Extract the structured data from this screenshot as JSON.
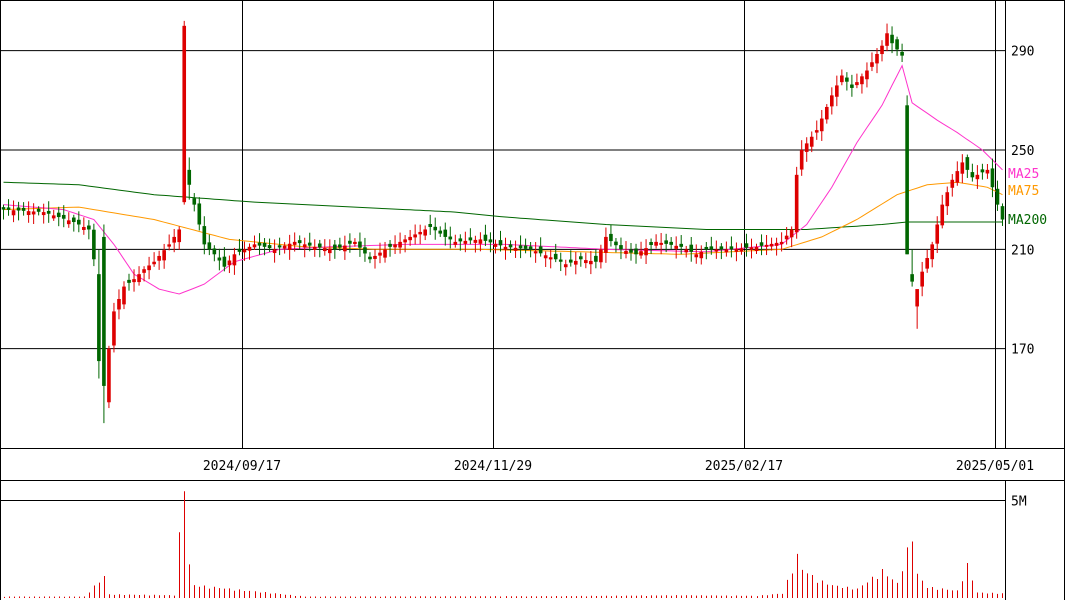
{
  "chart_data": {
    "type": "candlestick",
    "price_axis": {
      "ylim": [
        130,
        310
      ],
      "ticks": [
        290,
        250,
        210,
        170
      ],
      "tick_labels": [
        "290",
        "250",
        "210",
        "170"
      ]
    },
    "volume_axis": {
      "ylim": [
        0,
        6
      ],
      "unit": "M",
      "ticks": [
        5
      ],
      "tick_labels": [
        "5M"
      ]
    },
    "x_axis": {
      "dates": [
        "2024/09/17",
        "2024/11/29",
        "2025/02/17",
        "2025/05/01"
      ],
      "date_index": [
        48,
        98,
        148,
        198
      ],
      "n_sessions": 200
    },
    "colors": {
      "up": "#dd0000",
      "down": "#006600",
      "ma25": "#ff33cc",
      "ma75": "#ff9900",
      "ma200": "#006600",
      "volume": "#dd0000",
      "grid": "#000000"
    },
    "legend": {
      "ma25": "MA25",
      "ma75": "MA75",
      "ma200": "MA200"
    },
    "close_anchors": [
      [
        0,
        226
      ],
      [
        8,
        225
      ],
      [
        14,
        221
      ],
      [
        17,
        218
      ],
      [
        18,
        206
      ],
      [
        19,
        177
      ],
      [
        20,
        150
      ],
      [
        21,
        170
      ],
      [
        22,
        185
      ],
      [
        24,
        195
      ],
      [
        26,
        198
      ],
      [
        28,
        202
      ],
      [
        30,
        205
      ],
      [
        33,
        212
      ],
      [
        35,
        218
      ],
      [
        36,
        235
      ],
      [
        38,
        228
      ],
      [
        40,
        212
      ],
      [
        42,
        208
      ],
      [
        44,
        203
      ],
      [
        46,
        208
      ],
      [
        50,
        212
      ],
      [
        54,
        210
      ],
      [
        58,
        213
      ],
      [
        62,
        211
      ],
      [
        66,
        210
      ],
      [
        70,
        213
      ],
      [
        73,
        206
      ],
      [
        76,
        210
      ],
      [
        80,
        214
      ],
      [
        85,
        219
      ],
      [
        88,
        215
      ],
      [
        90,
        213
      ],
      [
        95,
        214
      ],
      [
        100,
        211
      ],
      [
        105,
        210
      ],
      [
        110,
        206
      ],
      [
        112,
        204
      ],
      [
        115,
        206
      ],
      [
        118,
        205
      ],
      [
        120,
        215
      ],
      [
        123,
        210
      ],
      [
        126,
        208
      ],
      [
        130,
        213
      ],
      [
        135,
        211
      ],
      [
        138,
        208
      ],
      [
        140,
        210
      ],
      [
        145,
        210
      ],
      [
        150,
        211
      ],
      [
        155,
        213
      ],
      [
        157,
        218
      ],
      [
        158,
        240
      ],
      [
        159,
        250
      ],
      [
        162,
        258
      ],
      [
        165,
        272
      ],
      [
        167,
        280
      ],
      [
        169,
        275
      ],
      [
        172,
        282
      ],
      [
        175,
        292
      ],
      [
        176,
        297
      ],
      [
        177,
        293
      ],
      [
        179,
        288
      ],
      [
        180,
        271
      ],
      [
        181,
        210
      ],
      [
        182,
        196
      ],
      [
        183,
        201
      ],
      [
        185,
        212
      ],
      [
        187,
        228
      ],
      [
        189,
        238
      ],
      [
        191,
        245
      ],
      [
        193,
        239
      ],
      [
        196,
        242
      ],
      [
        198,
        228
      ],
      [
        199,
        222
      ]
    ],
    "ma25_anchors": [
      [
        0,
        228
      ],
      [
        12,
        226
      ],
      [
        18,
        222
      ],
      [
        22,
        212
      ],
      [
        26,
        200
      ],
      [
        31,
        194
      ],
      [
        35,
        192
      ],
      [
        40,
        196
      ],
      [
        46,
        205
      ],
      [
        55,
        210
      ],
      [
        65,
        211
      ],
      [
        80,
        212
      ],
      [
        100,
        212
      ],
      [
        120,
        210
      ],
      [
        140,
        209
      ],
      [
        155,
        212
      ],
      [
        160,
        220
      ],
      [
        165,
        235
      ],
      [
        170,
        253
      ],
      [
        175,
        268
      ],
      [
        179,
        284
      ],
      [
        181,
        269
      ],
      [
        186,
        262
      ],
      [
        190,
        257
      ],
      [
        195,
        250
      ],
      [
        199,
        242
      ]
    ],
    "ma75_anchors": [
      [
        0,
        226
      ],
      [
        15,
        227
      ],
      [
        30,
        222
      ],
      [
        45,
        214
      ],
      [
        60,
        211
      ],
      [
        75,
        210
      ],
      [
        95,
        210
      ],
      [
        115,
        209
      ],
      [
        135,
        208
      ],
      [
        155,
        210
      ],
      [
        163,
        215
      ],
      [
        170,
        222
      ],
      [
        178,
        232
      ],
      [
        184,
        236
      ],
      [
        190,
        237
      ],
      [
        196,
        235
      ],
      [
        199,
        232
      ]
    ],
    "ma200_anchors": [
      [
        0,
        237
      ],
      [
        15,
        236
      ],
      [
        30,
        232
      ],
      [
        50,
        229
      ],
      [
        70,
        227
      ],
      [
        90,
        225
      ],
      [
        100,
        223
      ],
      [
        120,
        220
      ],
      [
        140,
        218
      ],
      [
        160,
        218
      ],
      [
        175,
        220
      ],
      [
        180,
        221
      ],
      [
        199,
        221
      ]
    ],
    "special_candles": [
      [
        19,
        200,
        165,
        158,
        210
      ],
      [
        20,
        215,
        155,
        140,
        220
      ],
      [
        36,
        229,
        300,
        228,
        302
      ],
      [
        37,
        242,
        236,
        230,
        247
      ],
      [
        180,
        268,
        208,
        208,
        272
      ],
      [
        181,
        200,
        197,
        195,
        210
      ],
      [
        182,
        187,
        194,
        178,
        192
      ]
    ],
    "volume_anchors": [
      [
        0,
        0.08
      ],
      [
        16,
        0.08
      ],
      [
        20,
        1.2
      ],
      [
        21,
        0.2
      ],
      [
        34,
        0.15
      ],
      [
        36,
        6.6
      ],
      [
        37,
        1.8
      ],
      [
        38,
        0.7
      ],
      [
        60,
        0.08
      ],
      [
        110,
        0.1
      ],
      [
        120,
        0.12
      ],
      [
        135,
        0.15
      ],
      [
        150,
        0.12
      ],
      [
        155,
        0.25
      ],
      [
        158,
        2.3
      ],
      [
        159,
        1.6
      ],
      [
        162,
        1.0
      ],
      [
        165,
        0.7
      ],
      [
        170,
        0.5
      ],
      [
        175,
        1.5
      ],
      [
        178,
        0.8
      ],
      [
        181,
        3.5
      ],
      [
        182,
        1.3
      ],
      [
        184,
        0.6
      ],
      [
        190,
        0.4
      ],
      [
        192,
        1.8
      ],
      [
        194,
        0.3
      ],
      [
        199,
        0.25
      ]
    ]
  }
}
